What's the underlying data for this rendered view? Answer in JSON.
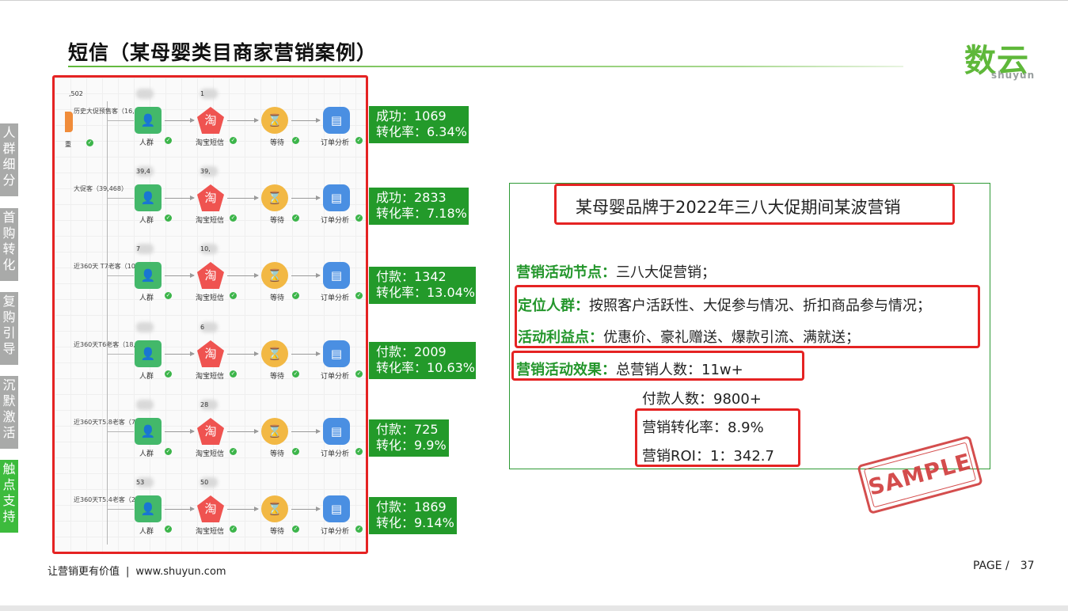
{
  "title": "短信（某母婴类目商家营销案例）",
  "logo": {
    "cn": "数云",
    "en": "shuyun"
  },
  "sidebar": [
    {
      "label": "人群细分",
      "active": false
    },
    {
      "label": "首购转化",
      "active": false
    },
    {
      "label": "复购引导",
      "active": false
    },
    {
      "label": "沉默激活",
      "active": false
    },
    {
      "label": "触点支持",
      "active": true
    }
  ],
  "flow": {
    "partial_top_count": ",502",
    "partial_node_label": "重",
    "node_labels": {
      "crowd": "人群",
      "sms": "淘宝短信",
      "wait": "等待",
      "order": "订单分析"
    },
    "rows": [
      {
        "segment": "历史大促预售客（16,864）",
        "count_crowd": "",
        "count_sms": "1"
      },
      {
        "segment": "大促客（39,468）",
        "count_crowd": "39,4",
        "count_sms": "39,"
      },
      {
        "segment": "近360天 T7老客（10,297）",
        "count_crowd": "7",
        "count_sms": "10,"
      },
      {
        "segment": "近360天T6老客（18,910）",
        "count_crowd": "",
        "count_sms": "6"
      },
      {
        "segment": "近360天T5.8老客（7,602）",
        "count_crowd": "",
        "count_sms": "28"
      },
      {
        "segment": "近360天T5.4老客（20,453）",
        "count_crowd": "53",
        "count_sms": "50"
      }
    ]
  },
  "results": [
    {
      "line1": "成功：1069",
      "line2": "转化率：6.34%"
    },
    {
      "line1": "成功：2833",
      "line2": "转化率：7.18%"
    },
    {
      "line1": "付款：1342",
      "line2": "转化率：13.04%"
    },
    {
      "line1": "付款：2009",
      "line2": "转化率：10.63%"
    },
    {
      "line1": "付款：725",
      "line2": "转化：9.9%"
    },
    {
      "line1": "付款：1869",
      "line2": "转化：9.14%"
    }
  ],
  "panel": {
    "heading": "某母婴品牌于2022年三八大促期间某波营销",
    "node_label": "营销活动节点：",
    "node_value": "三八大促营销；",
    "target_label": "定位人群：",
    "target_value": "按照客户活跃性、大促参与情况、折扣商品参与情况；",
    "benefit_label": "活动利益点：",
    "benefit_value": "优惠价、豪礼赠送、爆款引流、满就送；",
    "effect_label": "营销活动效果：",
    "effect_value": "总营销人数：11w+",
    "pay_count": "付款人数：9800+",
    "conversion": "营销转化率：8.9%",
    "roi": "营销ROI：1：342.7"
  },
  "stamp": "SAMPLE",
  "footer": {
    "slogan": "让营销更有价值",
    "separator": "|",
    "url": "www.shuyun.com"
  },
  "page": {
    "label": "PAGE /",
    "number": "37"
  }
}
